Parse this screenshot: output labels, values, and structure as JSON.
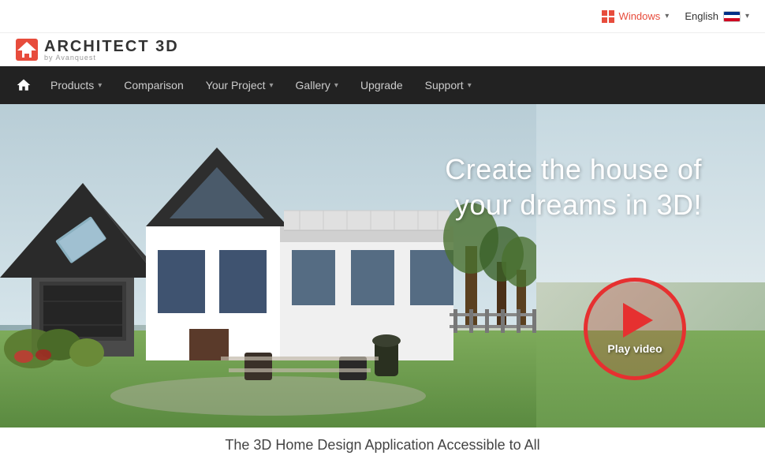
{
  "brand": {
    "name": "ARCHITECT 3D",
    "subtitle": "by Avanquest",
    "logo_color": "#e74c3c"
  },
  "topbar": {
    "windows_label": "Windows",
    "language_label": "English"
  },
  "navbar": {
    "home_tooltip": "Home",
    "items": [
      {
        "label": "Products",
        "has_dropdown": true
      },
      {
        "label": "Comparison",
        "has_dropdown": false
      },
      {
        "label": "Your Project",
        "has_dropdown": true
      },
      {
        "label": "Gallery",
        "has_dropdown": true
      },
      {
        "label": "Upgrade",
        "has_dropdown": false
      },
      {
        "label": "Support",
        "has_dropdown": true
      }
    ]
  },
  "hero": {
    "headline_line1": "Create the house of",
    "headline_line2": "your dreams in 3D!",
    "play_button_label": "Play video"
  },
  "tagline": {
    "text": "The 3D Home Design Application Accessible to All"
  }
}
